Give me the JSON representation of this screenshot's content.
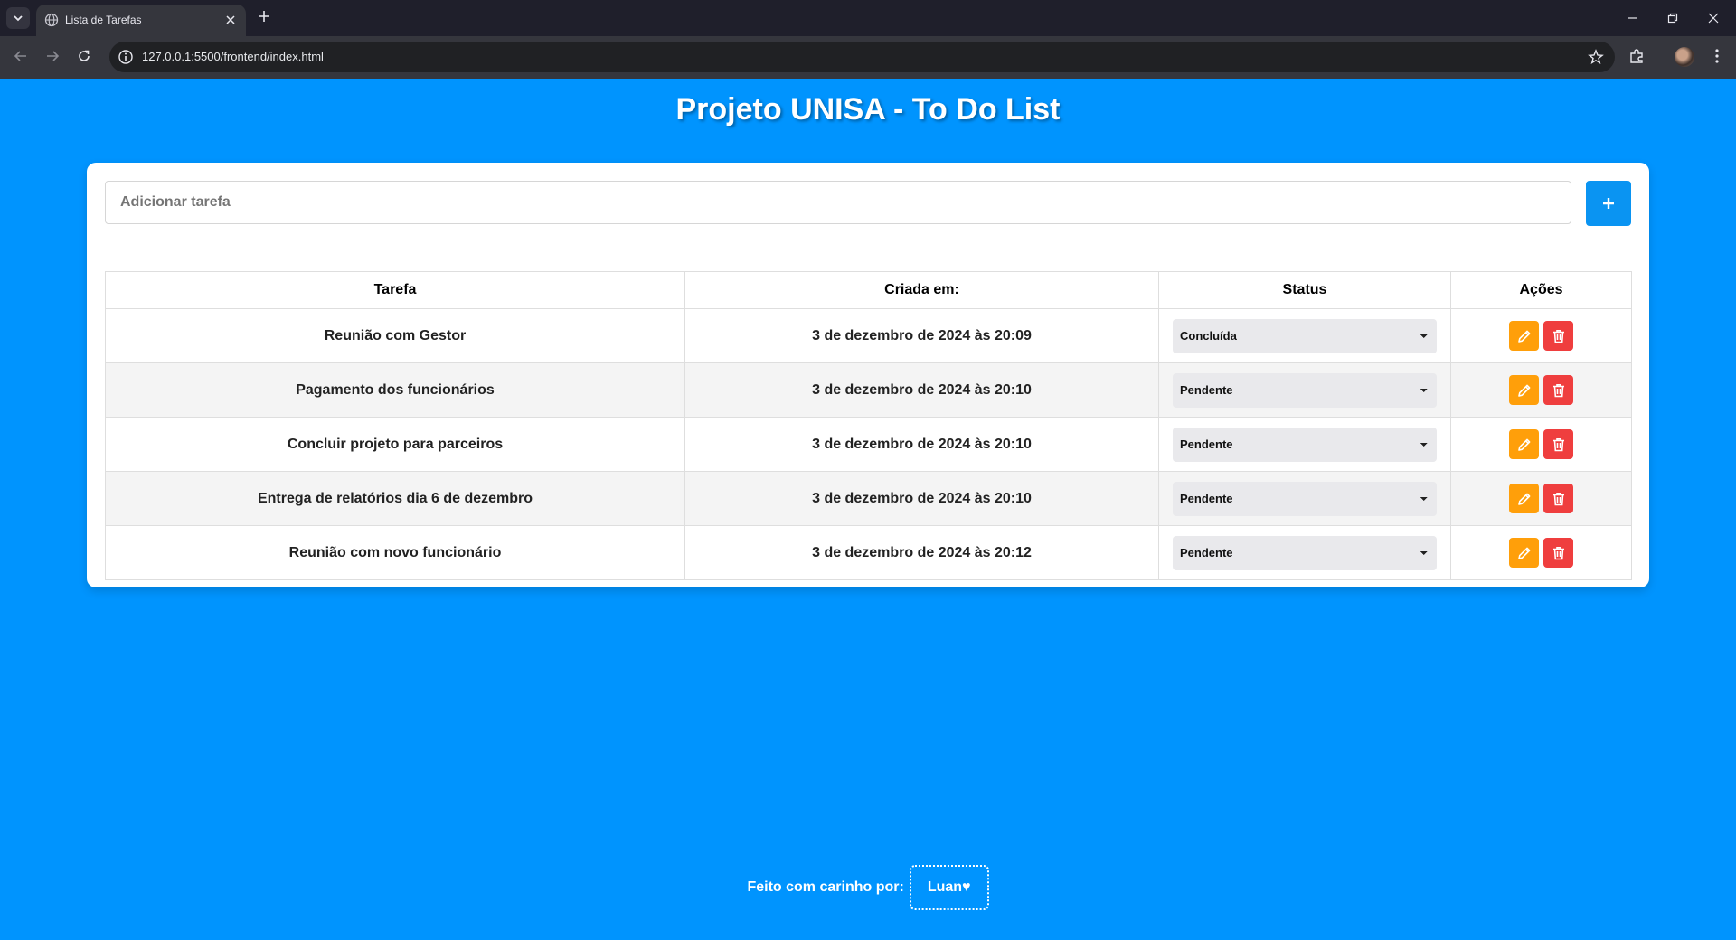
{
  "browser": {
    "tab_title": "Lista de Tarefas",
    "url": "127.0.0.1:5500/frontend/index.html"
  },
  "page": {
    "title": "Projeto UNISA - To Do List",
    "input_placeholder": "Adicionar tarefa",
    "add_button_label": "+"
  },
  "table": {
    "headers": [
      "Tarefa",
      "Criada em:",
      "Status",
      "Ações"
    ],
    "rows": [
      {
        "task": "Reunião com Gestor",
        "created": "3 de dezembro de 2024 às 20:09",
        "status": "Concluída"
      },
      {
        "task": "Pagamento dos funcionários",
        "created": "3 de dezembro de 2024 às 20:10",
        "status": "Pendente"
      },
      {
        "task": "Concluir projeto para parceiros",
        "created": "3 de dezembro de 2024 às 20:10",
        "status": "Pendente"
      },
      {
        "task": "Entrega de relatórios dia 6 de dezembro",
        "created": "3 de dezembro de 2024 às 20:10",
        "status": "Pendente"
      },
      {
        "task": "Reunião com novo funcionário",
        "created": "3 de dezembro de 2024 às 20:12",
        "status": "Pendente"
      }
    ]
  },
  "footer": {
    "text": "Feito com carinho por:",
    "author": "Luan♥"
  },
  "colors": {
    "background": "#0094fe",
    "add_button": "#0a94f2",
    "edit_button": "#ff9f0a",
    "delete_button": "#ef3e3e"
  },
  "icons": {
    "add": "plus-icon",
    "edit": "pencil-icon",
    "delete": "trash-icon"
  }
}
